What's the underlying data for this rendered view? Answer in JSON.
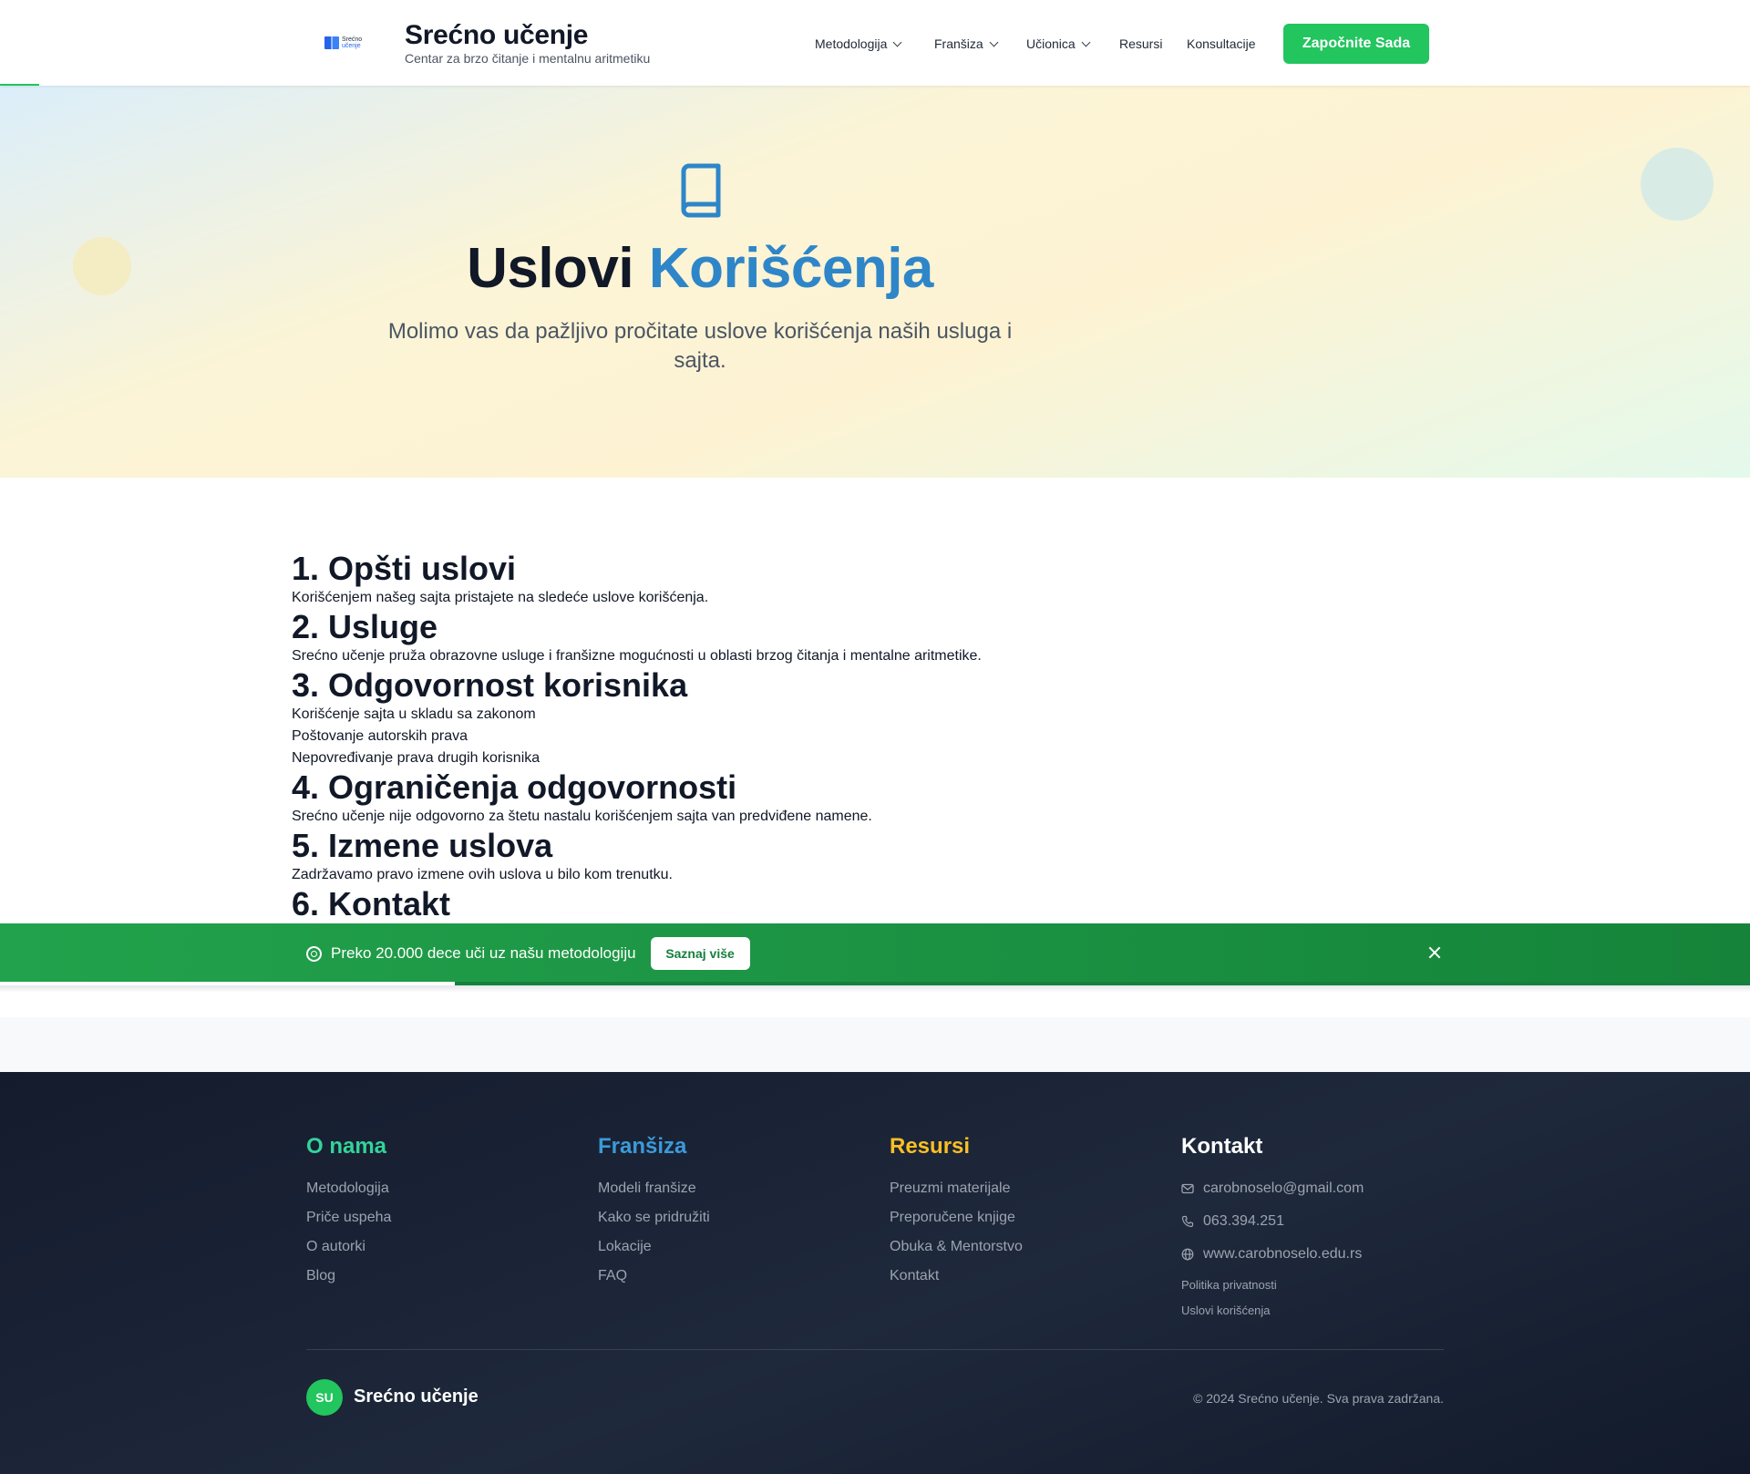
{
  "header": {
    "logo_text_top": "Srećno",
    "logo_text_bottom": "učenje",
    "brand_title": "Srećno učenje",
    "brand_subtitle": "Centar za brzo čitanje i mentalnu aritmetiku",
    "nav": {
      "metodologija": "Metodologija",
      "fransiza": "Franšiza",
      "ucionica": "Učionica",
      "resursi": "Resursi",
      "konsultacije": "Konsultacije"
    },
    "cta": "Započnite Sada"
  },
  "hero": {
    "title_part1": "Uslovi",
    "title_part2": "Korišćenja",
    "subtitle": "Molimo vas da pažljivo pročitate uslove korišćenja naših usluga i sajta.",
    "icon": "book-icon"
  },
  "sections": {
    "s1": {
      "title": "1. Opšti uslovi",
      "text": "Korišćenjem našeg sajta pristajete na sledeće uslove korišćenja."
    },
    "s2": {
      "title": "2. Usluge",
      "text": "Srećno učenje pruža obrazovne usluge i franšizne mogućnosti u oblasti brzog čitanja i mentalne aritmetike."
    },
    "s3": {
      "title": "3. Odgovornost korisnika",
      "items": [
        "Korišćenje sajta u skladu sa zakonom",
        "Poštovanje autorskih prava",
        "Nepovređivanje prava drugih korisnika"
      ]
    },
    "s4": {
      "title": "4. Ograničenja odgovornosti",
      "text": "Srećno učenje nije odgovorno za štetu nastalu korišćenjem sajta van predviđene namene."
    },
    "s5": {
      "title": "5. Izmene uslova",
      "text": "Zadržavamo pravo izmene ovih uslova u bilo kom trenutku."
    },
    "s6": {
      "title": "6. Kontakt"
    }
  },
  "banner": {
    "text": "Preko 20.000 dece uči uz našu metodologiju",
    "button": "Saznaj više",
    "progress": 0.26,
    "icon": "target-icon"
  },
  "footer": {
    "col1": {
      "title": "O nama",
      "color": "#34d399",
      "links": [
        "Metodologija",
        "Priče uspeha",
        "O autorki",
        "Blog"
      ]
    },
    "col2": {
      "title": "Franšiza",
      "color": "#3b9ad9",
      "links": [
        "Modeli franšize",
        "Kako se pridružiti",
        "Lokacije",
        "FAQ"
      ]
    },
    "col3": {
      "title": "Resursi",
      "color": "#fbbf24",
      "links": [
        "Preuzmi materijale",
        "Preporučene knjige",
        "Obuka & Mentorstvo",
        "Kontakt"
      ]
    },
    "col4": {
      "title": "Kontakt",
      "color": "#ffffff",
      "email": "carobnoselo@gmail.com",
      "phone": "063.394.251",
      "website": "www.carobnoselo.edu.rs",
      "links": [
        "Politika privatnosti",
        "Uslovi korišćenja"
      ]
    },
    "badge": "SU",
    "brand": "Srećno učenje",
    "copyright": "© 2024 Srećno učenje. Sva prava zadržana."
  },
  "colors": {
    "accent_green": "#22c55e",
    "accent_blue": "#2e86c9",
    "footer_bg": "#1e293b"
  }
}
